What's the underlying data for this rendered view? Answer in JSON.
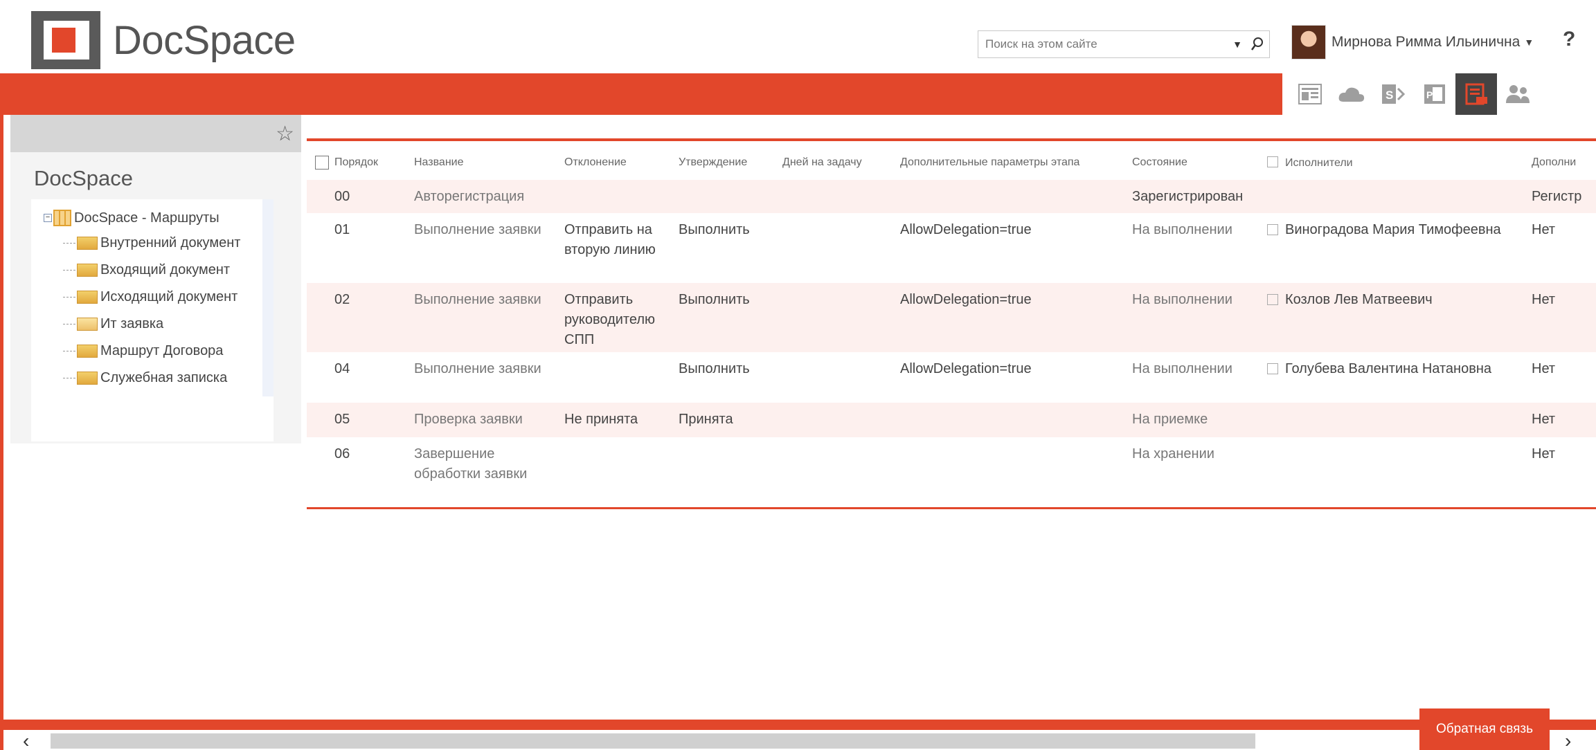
{
  "header": {
    "logo_text": "DocSpace",
    "search_placeholder": "Поиск на этом сайте",
    "user_name": "Мирнова Римма Ильинична",
    "help_label": "?"
  },
  "suite_icons": [
    "newsfeed-icon",
    "onedrive-icon",
    "sharepoint-icon",
    "project-icon",
    "routes-icon",
    "people-icon"
  ],
  "sidebar": {
    "title": "DocSpace",
    "tree_root": "DocSpace - Маршруты",
    "items": [
      {
        "label": "Внутренний документ"
      },
      {
        "label": "Входящий документ"
      },
      {
        "label": "Исходящий документ"
      },
      {
        "label": "Ит заявка"
      },
      {
        "label": "Маршрут Договора"
      },
      {
        "label": "Служебная записка"
      }
    ]
  },
  "table": {
    "headers": {
      "order": "Порядок",
      "name": "Название",
      "reject": "Отклонение",
      "approve": "Утверждение",
      "days": "Дней на задачу",
      "params": "Дополнительные параметры этапа",
      "state": "Состояние",
      "performers": "Исполнители",
      "extra": "Дополни"
    },
    "rows": [
      {
        "order": "00",
        "name": "Авторегистрация",
        "reject": "",
        "approve": "",
        "days": "",
        "params": "",
        "state": "Зарегистрирован",
        "performer": "",
        "extra": "Регистр"
      },
      {
        "order": "01",
        "name": "Выполнение заявки",
        "reject": "Отправить на вторую линию",
        "approve": "Выполнить",
        "days": "",
        "params": "AllowDelegation=true",
        "state": "На выполнении",
        "performer": "Виноградова Мария Тимофеевна",
        "extra": "Нет"
      },
      {
        "order": "02",
        "name": "Выполнение заявки",
        "reject": "Отправить руководителю СПП",
        "approve": "Выполнить",
        "days": "",
        "params": "AllowDelegation=true",
        "state": "На выполнении",
        "performer": "Козлов Лев Матвеевич",
        "extra": "Нет"
      },
      {
        "order": "04",
        "name": "Выполнение заявки",
        "reject": "",
        "approve": "Выполнить",
        "days": "",
        "params": "AllowDelegation=true",
        "state": "На выполнении",
        "performer": "Голубева Валентина Натановна",
        "extra": "Нет"
      },
      {
        "order": "05",
        "name": "Проверка заявки",
        "reject": "Не принята",
        "approve": "Принята",
        "days": "",
        "params": "",
        "state": "На приемке",
        "performer": "",
        "extra": "Нет"
      },
      {
        "order": "06",
        "name": "Завершение обработки заявки",
        "reject": "",
        "approve": "",
        "days": "",
        "params": "",
        "state": "На хранении",
        "performer": "",
        "extra": "Нет"
      }
    ]
  },
  "footer": {
    "feedback_label": "Обратная связь"
  },
  "colors": {
    "accent": "#e2472b",
    "row_alt": "#fdf0ee"
  }
}
